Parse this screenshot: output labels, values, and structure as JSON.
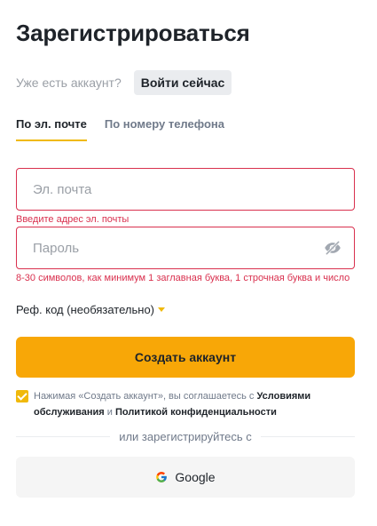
{
  "title": "Зарегистрироваться",
  "login": {
    "question": "Уже есть аккаунт?",
    "button": "Войти сейчас"
  },
  "tabs": [
    {
      "label": "По эл. почте",
      "active": true
    },
    {
      "label": "По номеру телефона",
      "active": false
    }
  ],
  "email": {
    "placeholder": "Эл. почта",
    "value": "",
    "error": "Введите адрес эл. почты"
  },
  "password": {
    "placeholder": "Пароль",
    "value": "",
    "error": "8-30 символов, как минимум 1 заглавная буква, 1 строчная буква и число",
    "icon": "eye-slash-icon"
  },
  "referral": {
    "label": "Реф. код (необязательно)",
    "icon": "caret-down-icon"
  },
  "create_button": "Создать аккаунт",
  "terms": {
    "checked": true,
    "prefix": "Нажимая «Создать аккаунт», вы соглашаетесь с ",
    "link1": "Условиями обслуживания",
    "middle": " и ",
    "link2": "Политикой конфиденциальности"
  },
  "divider_text": "или зарегистрируйтесь с",
  "google": {
    "label": "Google",
    "icon": "google-icon"
  },
  "colors": {
    "accent": "#f0b90b",
    "button": "#f8a707",
    "error": "#d9304e",
    "text": "#1e2329",
    "muted": "#707a8a"
  }
}
